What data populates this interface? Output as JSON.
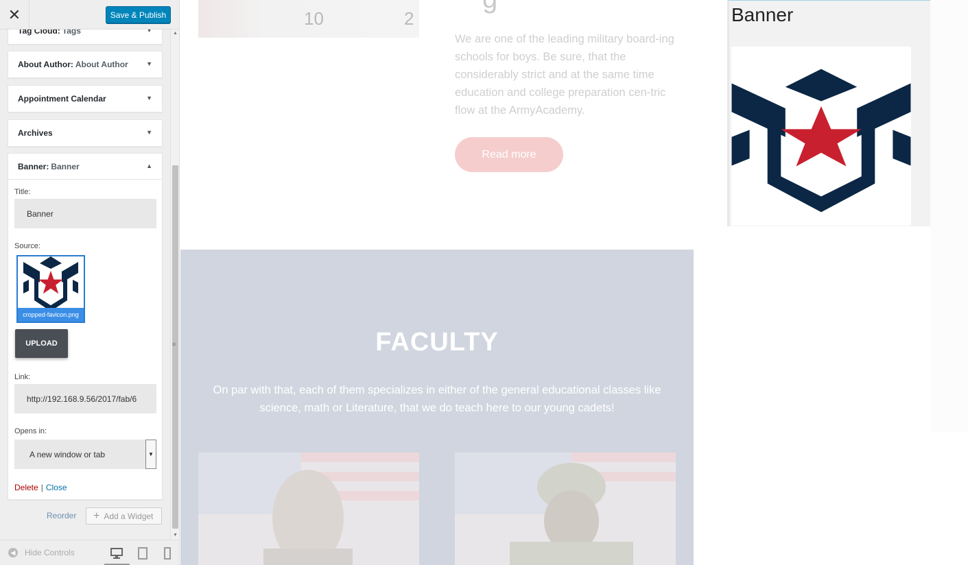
{
  "topbar": {
    "close_symbol": "✕",
    "save_label": "Save & Publish"
  },
  "widgets": [
    {
      "label": "Tag Cloud:",
      "sub": "Tags"
    },
    {
      "label": "About Author:",
      "sub": "About Author"
    },
    {
      "label": "Appointment Calendar",
      "sub": ""
    },
    {
      "label": "Archives",
      "sub": ""
    }
  ],
  "banner_widget": {
    "label": "Banner:",
    "sub": "Banner",
    "title_label": "Title:",
    "title_value": "Banner",
    "source_label": "Source:",
    "source_filename": "cropped-favicon.png",
    "upload_label": "UPLOAD",
    "link_label": "Link:",
    "link_value": "http://192.168.9.56/2017/fab/6",
    "opens_label": "Opens in:",
    "opens_value": "A new window or tab",
    "delete_label": "Delete",
    "separator": "|",
    "close_label": "Close"
  },
  "sidebar_actions": {
    "reorder_label": "Reorder",
    "add_widget_label": "Add a Widget"
  },
  "footer": {
    "hide_controls_label": "Hide Controls"
  },
  "preview": {
    "hero_heading_fragment": "g",
    "clock_numbers": [
      "10",
      "2"
    ],
    "intro_text": "We are one of the leading military board-ing schools for boys. Be sure, that the considerably strict and at the same time education and college preparation cen-tric flow at the ArmyAcademy.",
    "read_more_label": "Read more",
    "faculty_title": "FACULTY",
    "faculty_text": "On par with that, each of them specializes in either of the general educational classes like science, math or Literature, that we do teach here to our young cadets!",
    "banner_title": "Banner"
  },
  "colors": {
    "primary_button": "#0085ba",
    "logo_navy": "#0b2745",
    "logo_red": "#c8202f",
    "read_more_bg": "#f5cdcd",
    "faculty_bg": "#d0d5df",
    "delete_link": "#aa0000",
    "close_link": "#0073aa"
  },
  "icons": {
    "close": "close-icon",
    "hide_controls": "arrow-left-circle-icon",
    "devices": [
      "desktop-icon",
      "tablet-icon",
      "mobile-icon"
    ]
  }
}
